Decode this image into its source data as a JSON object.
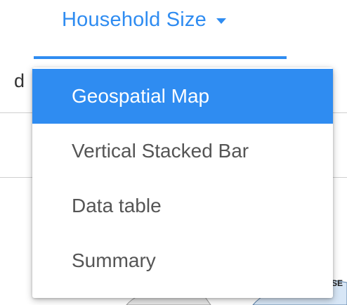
{
  "tab": {
    "title": "Household Size"
  },
  "background": {
    "fragment_text": "d",
    "map_label": "SE"
  },
  "menu": {
    "selected_index": 0,
    "items": [
      {
        "label": "Geospatial Map"
      },
      {
        "label": "Vertical Stacked Bar"
      },
      {
        "label": "Data table"
      },
      {
        "label": "Summary"
      }
    ]
  },
  "colors": {
    "accent": "#2f8cf1",
    "menu_text": "#555555"
  }
}
